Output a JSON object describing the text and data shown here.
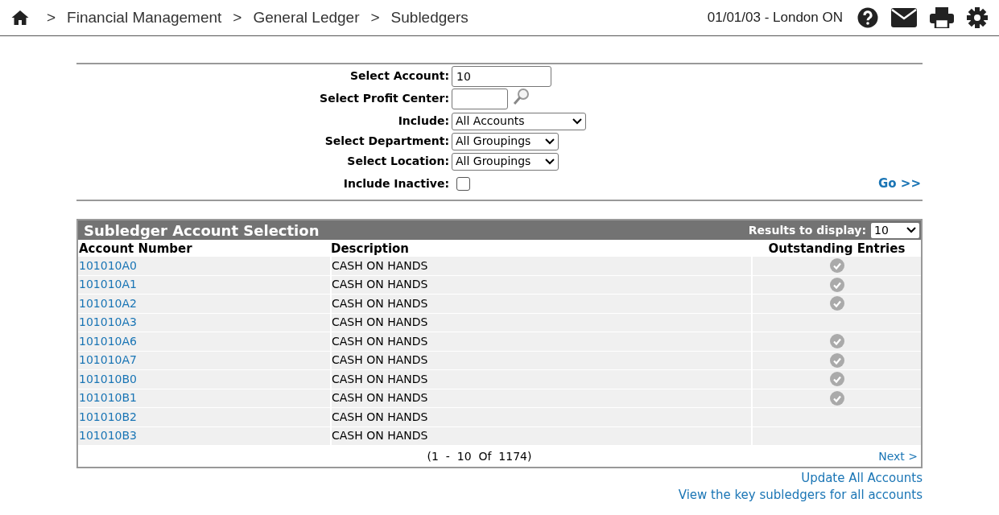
{
  "header": {
    "breadcrumbs": [
      {
        "label": "Financial Management"
      },
      {
        "label": "General Ledger"
      },
      {
        "label": "Subledgers"
      }
    ],
    "separator": ">",
    "context": "01/01/03 - London ON"
  },
  "filter_form": {
    "fields": [
      {
        "kind": "text",
        "label": "Select Account:",
        "value": "10"
      },
      {
        "kind": "lookup",
        "label": "Select Profit Center:"
      },
      {
        "kind": "select",
        "label": "Include:",
        "value": "All Accounts"
      },
      {
        "kind": "select",
        "label": "Select Department:",
        "value": "All Groupings"
      },
      {
        "kind": "select",
        "label": "Select Location:",
        "value": "All Groupings"
      },
      {
        "kind": "checkbox",
        "label": "Include Inactive:",
        "checked": false
      }
    ],
    "go_link": "Go >>"
  },
  "table": {
    "title": "Subledger Account Selection",
    "results_label": "Results to display:",
    "results_value": "10",
    "columns": [
      "Account Number",
      "Description",
      "Outstanding Entries"
    ],
    "rows": [
      {
        "account": "101010A0",
        "description": "CASH ON HANDS",
        "outstanding": true
      },
      {
        "account": "101010A1",
        "description": "CASH ON HANDS",
        "outstanding": true
      },
      {
        "account": "101010A2",
        "description": "CASH ON HANDS",
        "outstanding": true
      },
      {
        "account": "101010A3",
        "description": "CASH ON HANDS",
        "outstanding": false
      },
      {
        "account": "101010A6",
        "description": "CASH ON HANDS",
        "outstanding": true
      },
      {
        "account": "101010A7",
        "description": "CASH ON HANDS",
        "outstanding": true
      },
      {
        "account": "101010B0",
        "description": "CASH ON HANDS",
        "outstanding": true
      },
      {
        "account": "101010B1",
        "description": "CASH ON HANDS",
        "outstanding": true
      },
      {
        "account": "101010B2",
        "description": "CASH ON HANDS",
        "outstanding": false
      },
      {
        "account": "101010B3",
        "description": "CASH ON HANDS",
        "outstanding": false
      }
    ],
    "pager": "(1  -  10  Of  1174)",
    "next_link": "Next >"
  },
  "links": [
    "Update All Accounts",
    "View the key subledgers for all accounts"
  ]
}
